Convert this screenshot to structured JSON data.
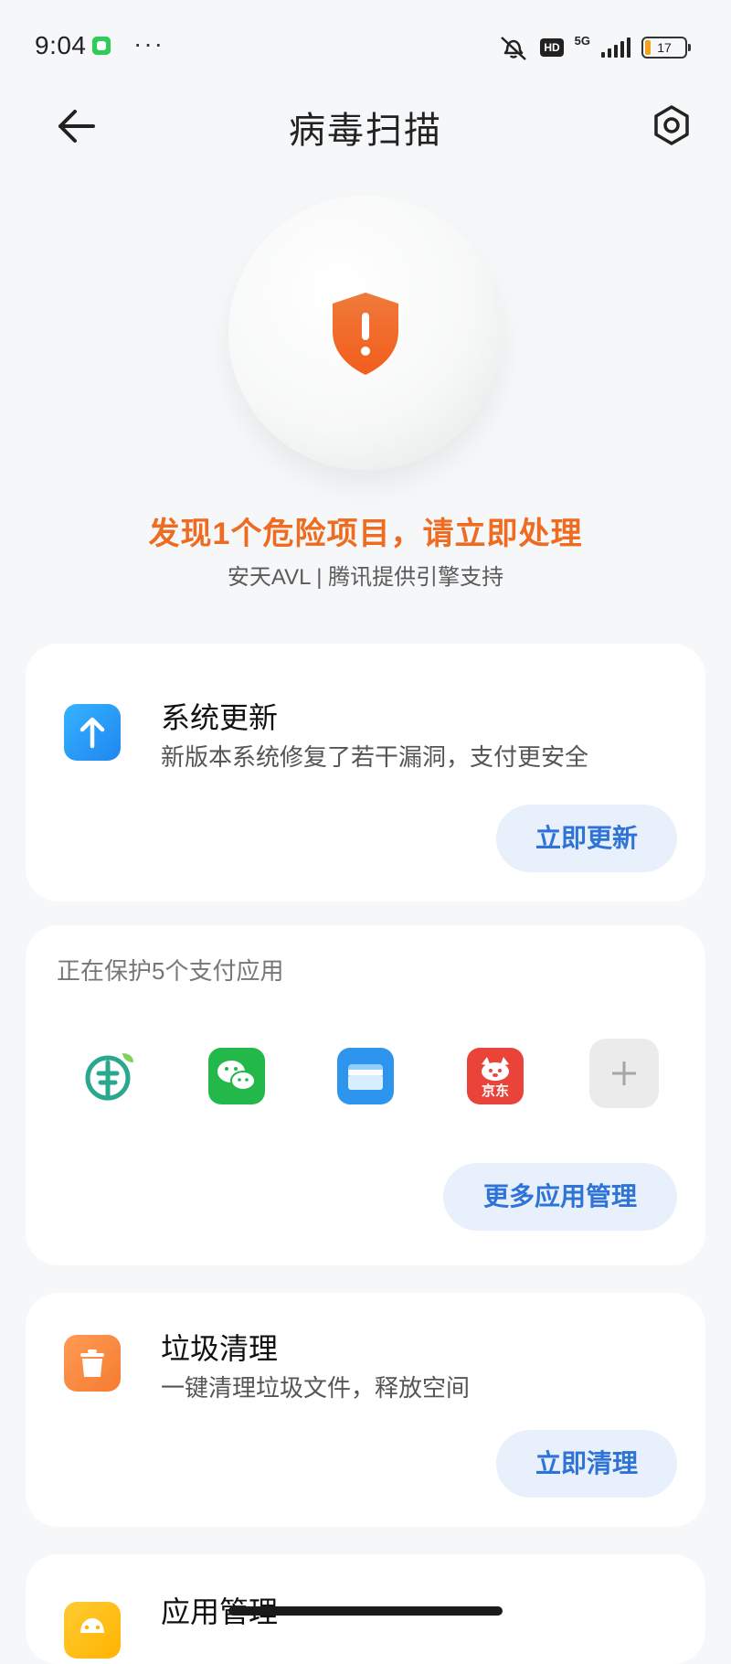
{
  "status_bar": {
    "time": "9:04",
    "more": "···",
    "network": "5G",
    "hd": "HD",
    "battery": "17"
  },
  "header": {
    "title": "病毒扫描"
  },
  "hero": {
    "title": "发现1个危险项目，请立即处理",
    "subtitle": "安天AVL | 腾讯提供引擎支持"
  },
  "system_update": {
    "title": "系统更新",
    "description": "新版本系统修复了若干漏洞，支付更安全",
    "button_label": "立即更新"
  },
  "payment_protection": {
    "heading": "正在保护5个支付应用",
    "apps": [
      {
        "name": "agricultural-bank-app",
        "color": "#2aa88e"
      },
      {
        "name": "wechat-app",
        "color": "#22b84a"
      },
      {
        "name": "wallet-app",
        "color": "#2d95ee"
      },
      {
        "name": "jd-app",
        "color": "#e9433a",
        "label": "京东"
      },
      {
        "name": "add-app",
        "color": "#ebebeb"
      }
    ],
    "button_label": "更多应用管理"
  },
  "junk_clean": {
    "title": "垃圾清理",
    "description": "一键清理垃圾文件，释放空间",
    "button_label": "立即清理"
  },
  "app_management": {
    "title": "应用管理"
  }
}
